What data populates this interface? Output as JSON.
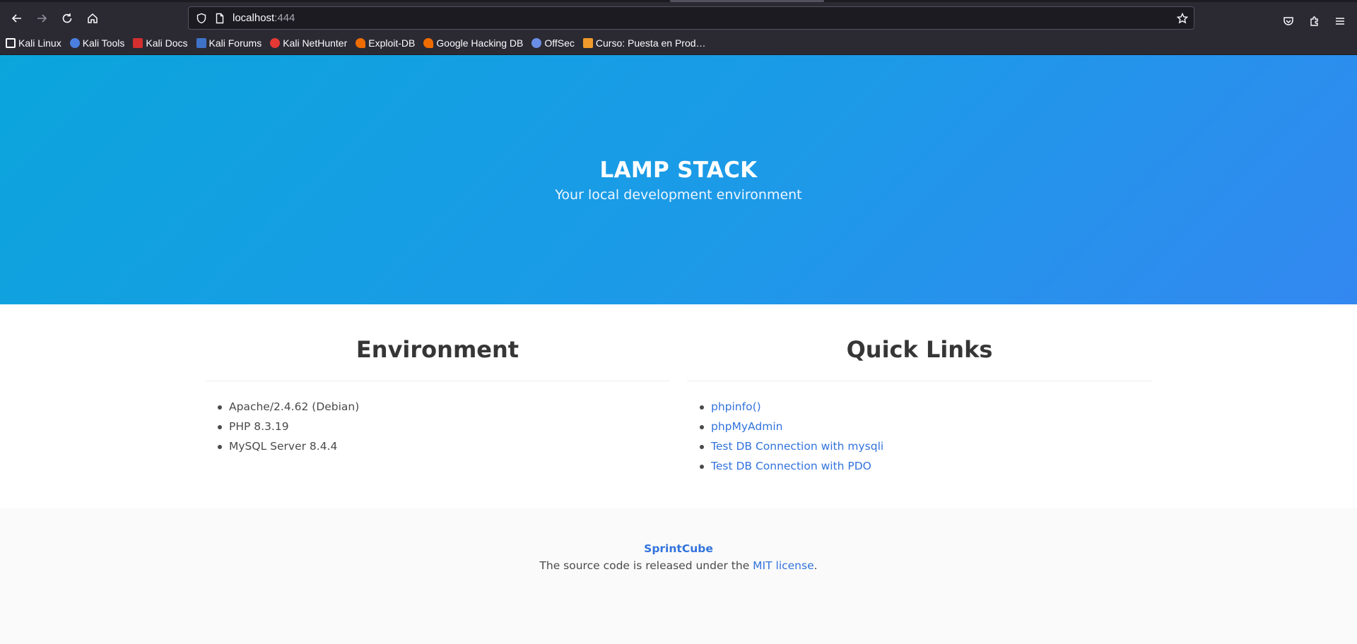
{
  "browser": {
    "url_host": "localhost",
    "url_port": ":444",
    "bookmarks": [
      {
        "label": "Kali Linux",
        "icon": "kali-dragon-icon",
        "color": "#ffffff"
      },
      {
        "label": "Kali Tools",
        "icon": "kali-tools-icon",
        "color": "#4a7fe0"
      },
      {
        "label": "Kali Docs",
        "icon": "kali-docs-icon",
        "color": "#d32f2f"
      },
      {
        "label": "Kali Forums",
        "icon": "kali-forums-icon",
        "color": "#3f73c9"
      },
      {
        "label": "Kali NetHunter",
        "icon": "nethunter-icon",
        "color": "#e53935"
      },
      {
        "label": "Exploit-DB",
        "icon": "exploit-db-icon",
        "color": "#ef6c00"
      },
      {
        "label": "Google Hacking DB",
        "icon": "ghdb-icon",
        "color": "#ef6c00"
      },
      {
        "label": "OffSec",
        "icon": "offsec-icon",
        "color": "#6a8ee6"
      },
      {
        "label": "Curso: Puesta en Prod…",
        "icon": "course-icon",
        "color": "#f09a2b"
      }
    ]
  },
  "hero": {
    "title": "LAMP STACK",
    "subtitle": "Your local development environment"
  },
  "environment": {
    "title": "Environment",
    "items": [
      "Apache/2.4.62 (Debian)",
      "PHP 8.3.19",
      "MySQL Server 8.4.4"
    ]
  },
  "quick_links": {
    "title": "Quick Links",
    "items": [
      "phpinfo()",
      "phpMyAdmin",
      "Test DB Connection with mysqli",
      "Test DB Connection with PDO"
    ]
  },
  "footer": {
    "brand": "SprintCube",
    "text_before": "The source code is released under the ",
    "link": "MIT license",
    "text_after": "."
  },
  "colors": {
    "link": "#3273dc",
    "hero_gradient_start": "#0ba5dc",
    "hero_gradient_end": "#3388f0"
  }
}
